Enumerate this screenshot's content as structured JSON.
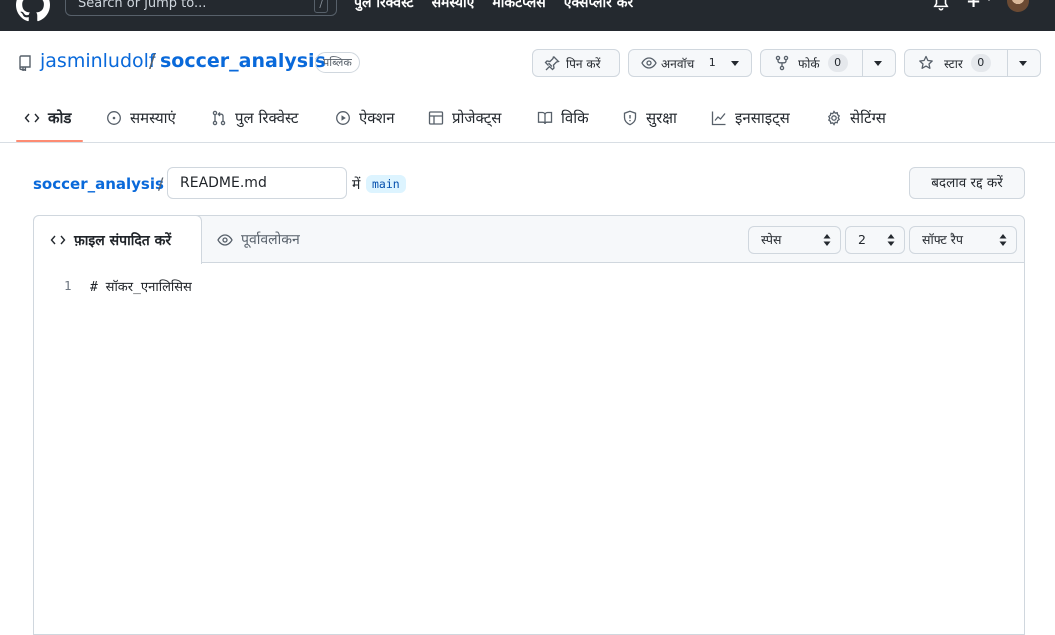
{
  "topbar": {
    "search_placeholder": "Search or jump to...",
    "search_shortcut": "/",
    "nav": [
      "पुल रिक्वेस्ट",
      "समस्याएं",
      "मार्केटप्लेस",
      "एक्सप्लोर करें"
    ]
  },
  "repo": {
    "owner": "jasminludolf",
    "separator": "/",
    "name": "soccer_analysis",
    "visibility": "पब्लिक",
    "pin_label": "पिन करें",
    "watch_label": "अनवॉच",
    "watch_count": "1",
    "fork_label": "फोर्क",
    "fork_count": "0",
    "star_label": "स्टार",
    "star_count": "0"
  },
  "tabs": [
    {
      "label": "कोड",
      "icon": "code-icon",
      "active": true
    },
    {
      "label": "समस्याएं",
      "icon": "issue-icon"
    },
    {
      "label": "पुल रिक्वेस्ट",
      "icon": "pull-request-icon"
    },
    {
      "label": "ऐक्शन",
      "icon": "play-icon"
    },
    {
      "label": "प्रोजेक्ट्स",
      "icon": "table-icon"
    },
    {
      "label": "विकि",
      "icon": "book-icon"
    },
    {
      "label": "सुरक्षा",
      "icon": "shield-icon"
    },
    {
      "label": "इनसाइट्स",
      "icon": "graph-icon"
    },
    {
      "label": "सेटिंग्स",
      "icon": "gear-icon"
    }
  ],
  "breadcrumb": {
    "repo": "soccer_analysis",
    "separator": "/",
    "filename": "README.md",
    "in_label": "में",
    "branch": "main",
    "cancel_label": "बदलाव रद्द करें"
  },
  "editor": {
    "edit_tab": "फ़ाइल संपादित करें",
    "preview_tab": "पूर्वावलोकन",
    "indent_mode": "स्पेस",
    "indent_size": "2",
    "wrap_mode": "सॉफ्ट रैप",
    "lines": [
      {
        "number": "1",
        "text": "# सॉकर_एनालिसिस"
      }
    ]
  }
}
